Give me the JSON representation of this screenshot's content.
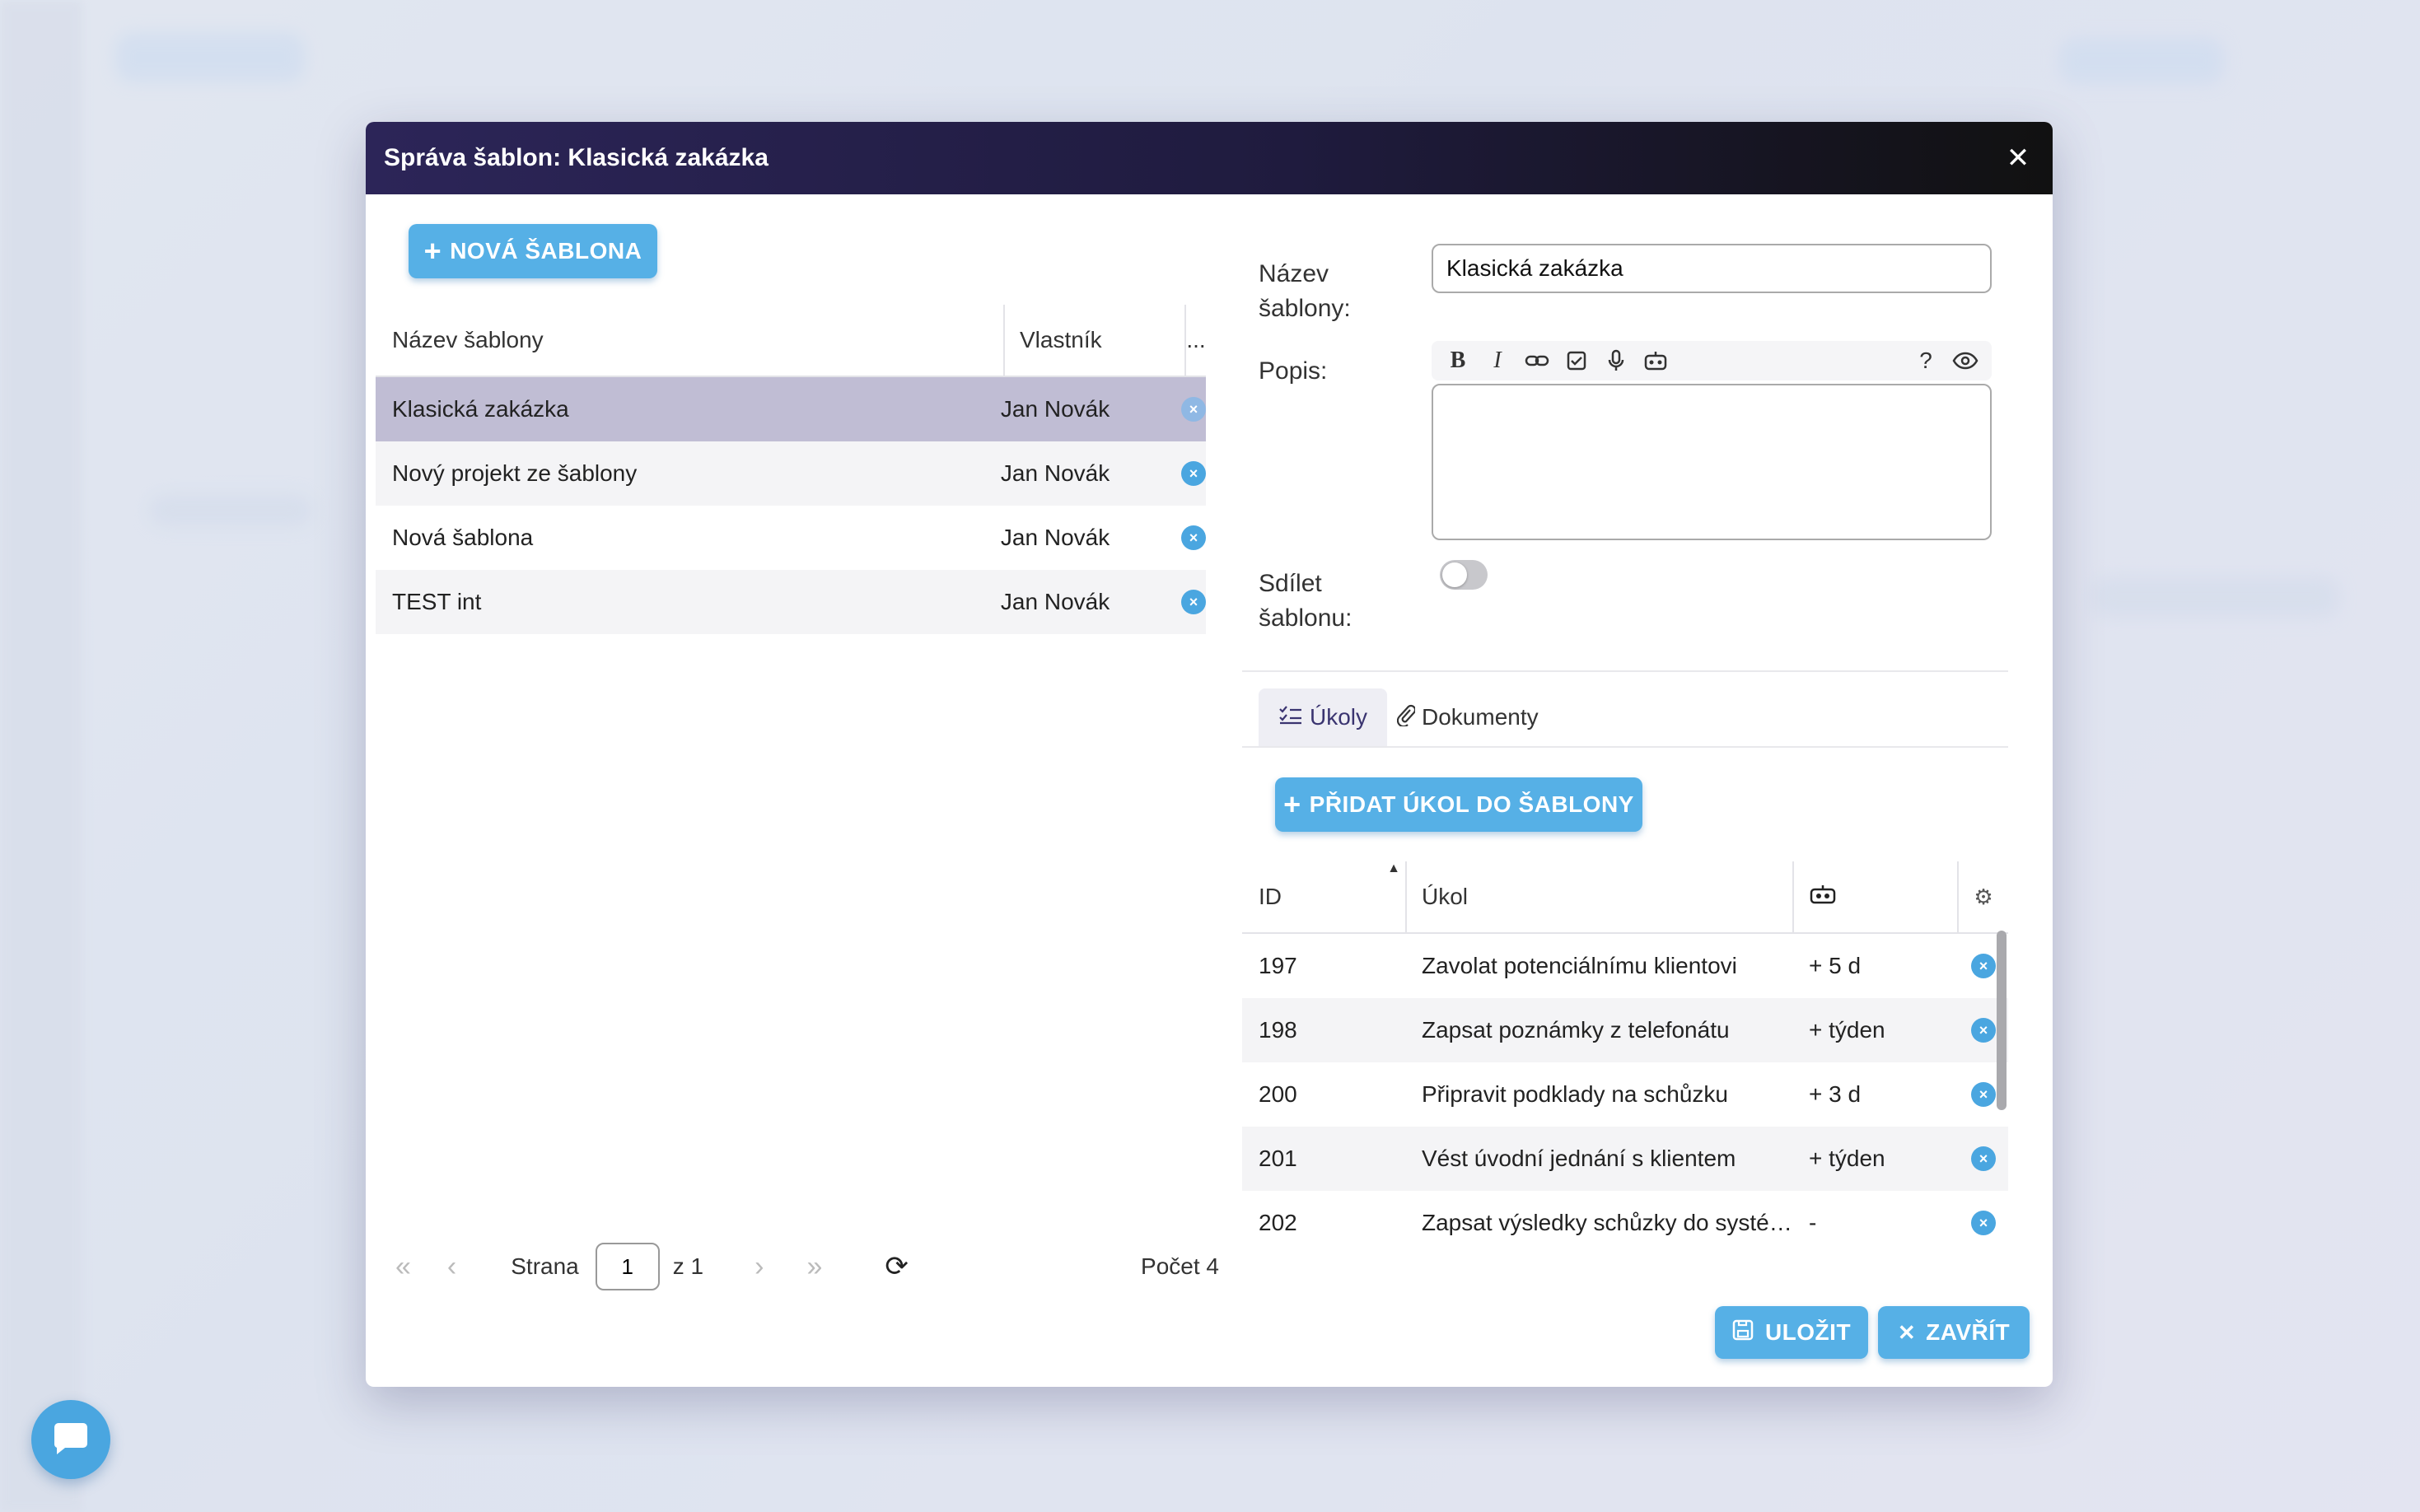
{
  "modal": {
    "title": "Správa šablon: Klasická zakázka",
    "close_icon": "close-icon"
  },
  "templates": {
    "new_button": "NOVÁ ŠABLONA",
    "columns": {
      "name": "Název šablony",
      "owner": "Vlastník",
      "actions": "..."
    },
    "rows": [
      {
        "name": "Klasická zakázka",
        "owner": "Jan Novák",
        "selected": true
      },
      {
        "name": "Nový projekt ze šablony",
        "owner": "Jan Novák"
      },
      {
        "name": "Nová šablona",
        "owner": "Jan Novák"
      },
      {
        "name": "TEST int",
        "owner": "Jan Novák"
      }
    ],
    "pager": {
      "page_label": "Strana",
      "page_value": "1",
      "of_label": "z 1",
      "count_label": "Počet 4"
    }
  },
  "form": {
    "name_label": "Název šablony:",
    "name_value": "Klasická zakázka",
    "description_label": "Popis:",
    "share_label": "Sdílet šablonu:",
    "share_on": false
  },
  "tabs": [
    {
      "label": "Úkoly",
      "icon": "checklist-icon",
      "active": true
    },
    {
      "label": "Dokumenty",
      "icon": "paperclip-icon",
      "active": false
    }
  ],
  "tasks": {
    "add_button": "PŘIDAT ÚKOL DO ŠABLONY",
    "columns": {
      "id": "ID",
      "task": "Úkol",
      "due_icon": "robot-icon",
      "settings_icon": "gear-icon"
    },
    "sort": {
      "column": "ID",
      "direction": "ascending"
    },
    "rows": [
      {
        "id": "197",
        "task": "Zavolat potenciálnímu klientovi",
        "due": "+ 5 d"
      },
      {
        "id": "198",
        "task": "Zapsat poznámky z telefonátu",
        "due": "+ týden"
      },
      {
        "id": "200",
        "task": "Připravit podklady na schůzku",
        "due": "+ 3 d"
      },
      {
        "id": "201",
        "task": "Vést úvodní jednání s klientem",
        "due": "+ týden"
      },
      {
        "id": "202",
        "task": "Zapsat výsledky schůzky do systému",
        "due": "-"
      }
    ]
  },
  "footer": {
    "save": "ULOŽIT",
    "close": "ZAVŘÍT"
  },
  "colors": {
    "accent": "#56b0e6",
    "header": "#2c2558",
    "selected_row": "#c0bdd4"
  }
}
